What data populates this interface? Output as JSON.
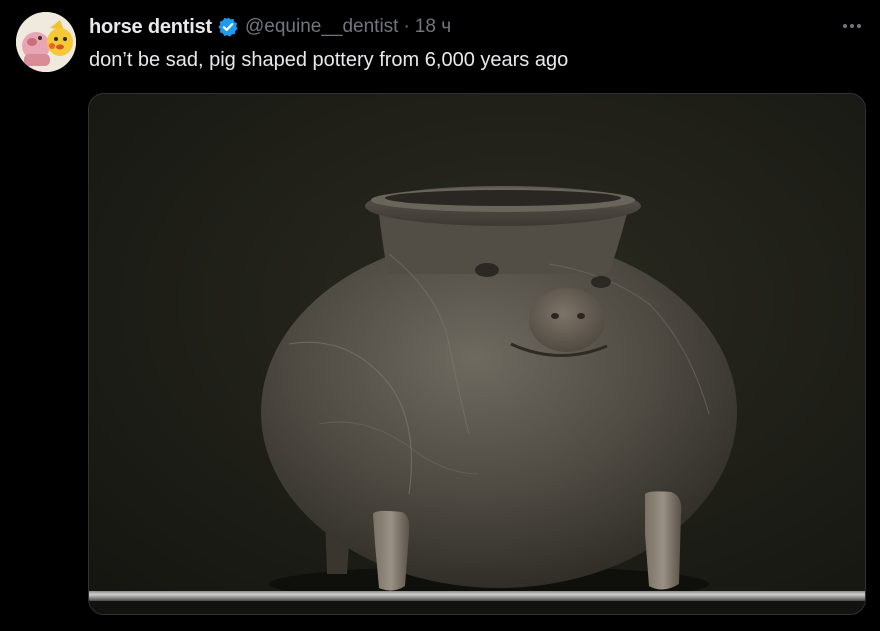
{
  "tweet": {
    "display_name": "horse dentist",
    "handle": "@equine__dentist",
    "separator": "·",
    "timestamp": "18 ч",
    "text": "don’t be sad, pig shaped pottery from 6,000 years ago",
    "verified": true
  },
  "icons": {
    "verified": "verified-badge-icon",
    "more": "more-options-icon"
  },
  "colors": {
    "background": "#000000",
    "primary_text": "#e7e9ea",
    "secondary_text": "#71767b",
    "verified_blue": "#1d9bf0",
    "media_border": "#2f3336"
  }
}
